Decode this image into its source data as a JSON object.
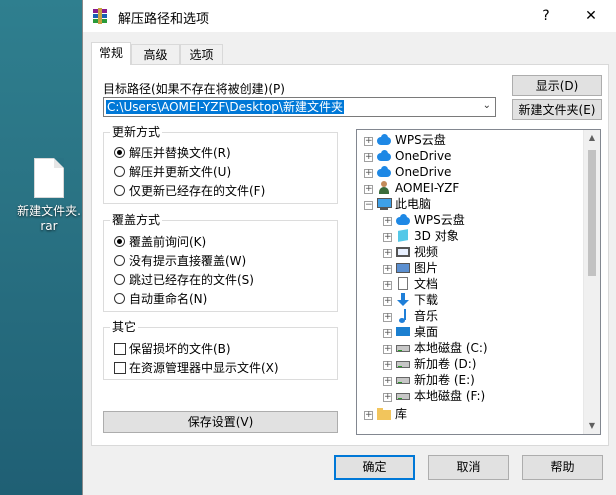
{
  "desktop": {
    "file_name_line1": "新建文件夹.",
    "file_name_line2": "rar"
  },
  "window": {
    "title": "解压路径和选项",
    "help_symbol": "?",
    "close_symbol": "✕"
  },
  "tabs": [
    {
      "label": "常规"
    },
    {
      "label": "高级"
    },
    {
      "label": "选项"
    }
  ],
  "general": {
    "target_label": "目标路径(如果不存在将被创建)(P)",
    "target_path": "C:\\Users\\AOMEI-YZF\\Desktop\\新建文件夹",
    "show_button": "显示(D)",
    "new_folder_button": "新建文件夹(E)",
    "update_group": {
      "title": "更新方式",
      "options": [
        {
          "label": "解压并替换文件(R)",
          "selected": true
        },
        {
          "label": "解压并更新文件(U)",
          "selected": false
        },
        {
          "label": "仅更新已经存在的文件(F)",
          "selected": false
        }
      ]
    },
    "overwrite_group": {
      "title": "覆盖方式",
      "options": [
        {
          "label": "覆盖前询问(K)",
          "selected": true
        },
        {
          "label": "没有提示直接覆盖(W)",
          "selected": false
        },
        {
          "label": "跳过已经存在的文件(S)",
          "selected": false
        },
        {
          "label": "自动重命名(N)",
          "selected": false
        }
      ]
    },
    "misc_group": {
      "title": "其它",
      "options": [
        {
          "label": "保留损坏的文件(B)",
          "checked": false
        },
        {
          "label": "在资源管理器中显示文件(X)",
          "checked": false
        }
      ]
    },
    "save_button": "保存设置(V)"
  },
  "tree": {
    "items": [
      {
        "label": "WPS云盘",
        "icon": "cloud-icon"
      },
      {
        "label": "OneDrive",
        "icon": "onedrive-icon"
      },
      {
        "label": "OneDrive",
        "icon": "onedrive-icon"
      },
      {
        "label": "AOMEI-YZF",
        "icon": "user-icon"
      },
      {
        "label": "此电脑",
        "icon": "computer-icon"
      },
      {
        "label": "WPS云盘",
        "icon": "cloud-icon"
      },
      {
        "label": "3D 对象",
        "icon": "3d-objects-icon"
      },
      {
        "label": "视频",
        "icon": "video-icon"
      },
      {
        "label": "图片",
        "icon": "pictures-icon"
      },
      {
        "label": "文档",
        "icon": "documents-icon"
      },
      {
        "label": "下载",
        "icon": "download-icon"
      },
      {
        "label": "音乐",
        "icon": "music-icon"
      },
      {
        "label": "桌面",
        "icon": "desktop-icon"
      },
      {
        "label": "本地磁盘 (C:)",
        "icon": "drive-icon"
      },
      {
        "label": "新加卷 (D:)",
        "icon": "drive-icon"
      },
      {
        "label": "新加卷 (E:)",
        "icon": "drive-icon"
      },
      {
        "label": "本地磁盘 (F:)",
        "icon": "drive-icon"
      },
      {
        "label": "库",
        "icon": "library-icon"
      }
    ]
  },
  "footer": {
    "ok": "确定",
    "cancel": "取消",
    "help": "帮助"
  },
  "colors": {
    "selection": "#0078d7",
    "dialog_bg": "#f0f0f0"
  }
}
